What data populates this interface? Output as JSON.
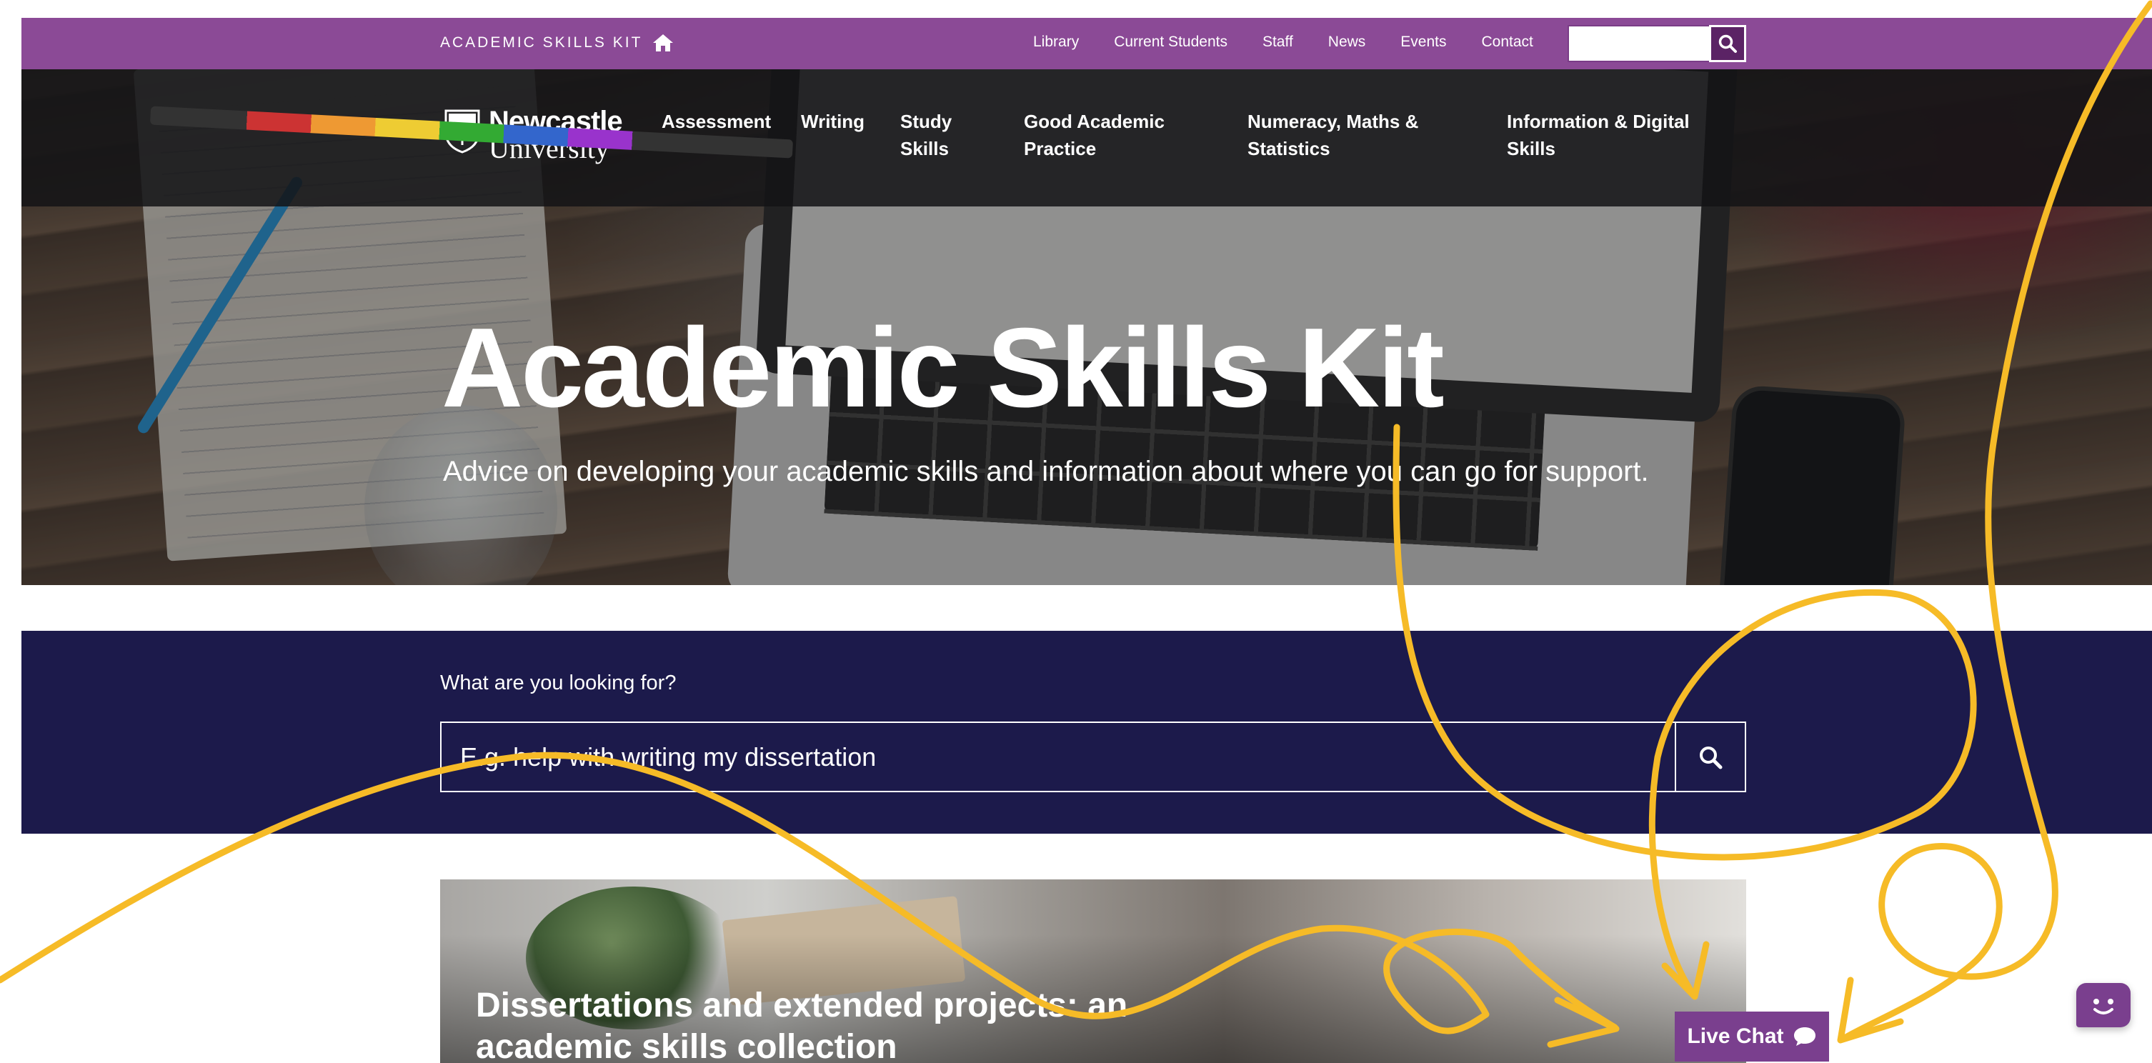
{
  "topbar": {
    "brand": "ACADEMIC SKILLS KIT",
    "links": [
      "Library",
      "Current Students",
      "Staff",
      "News",
      "Events",
      "Contact"
    ],
    "search_placeholder": "",
    "accent": "#8b4a96"
  },
  "header": {
    "logo_line1": "Newcastle",
    "logo_line2": "University",
    "nav": {
      "assessment": "Assessment",
      "writing": "Writing",
      "study_1": "Study",
      "study_2": "Skills",
      "gap_1": "Good Academic",
      "gap_2": "Practice",
      "num_1": "Numeracy, Maths &",
      "num_2": "Statistics",
      "info_1": "Information & Digital",
      "info_2": "Skills"
    }
  },
  "hero": {
    "title": "Academic Skills Kit",
    "subtitle": "Advice on developing your academic skills and information about where you can go for support."
  },
  "search": {
    "label": "What are you looking for?",
    "placeholder": "E.g. help with writing my dissertation",
    "band_color": "#1c1a4b"
  },
  "feature": {
    "title": "Dissertations and extended projects: an academic skills collection"
  },
  "chat": {
    "live_chat_label": "Live Chat",
    "accent": "#7a3f8e"
  },
  "annotation_color": "#f6bb27"
}
